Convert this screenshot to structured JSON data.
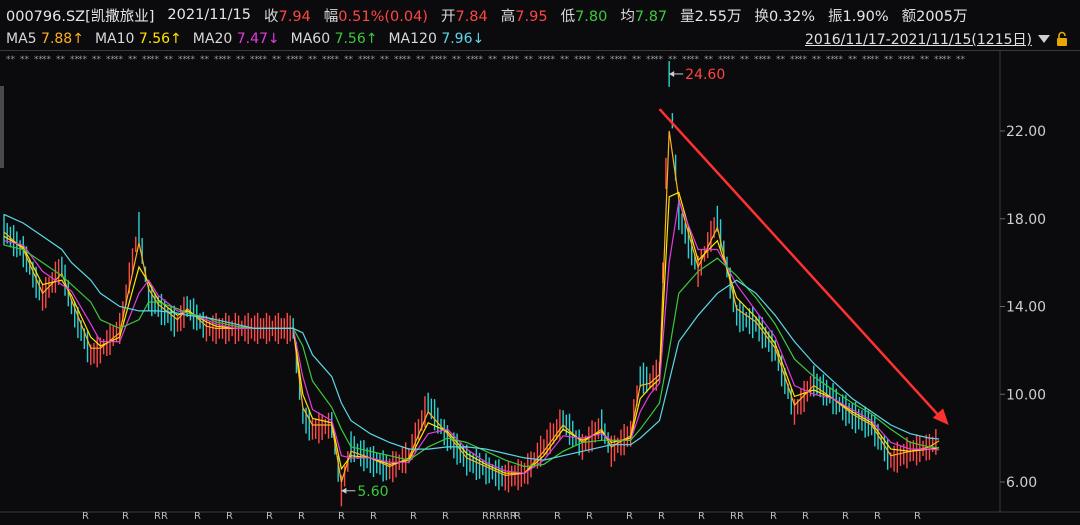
{
  "header": {
    "code": "000796.SZ[凯撒旅业]",
    "date": "2021/11/15",
    "close_label": "收",
    "close": "7.94",
    "change_label": "幅",
    "change": "0.51%(0.04)",
    "open_label": "开",
    "open": "7.84",
    "high_label": "高",
    "high": "7.95",
    "low_label": "低",
    "low": "7.80",
    "avg_label": "均",
    "avg": "7.87",
    "volume_label": "量",
    "volume": "2.55万",
    "turnover_label": "换",
    "turnover": "0.32%",
    "amplitude_label": "振",
    "amplitude": "1.90%",
    "amount_label": "额",
    "amount": "2005万"
  },
  "ma": [
    {
      "label": "MA5",
      "value": "7.88↑",
      "color": "#ffb020"
    },
    {
      "label": "MA10",
      "value": "7.56↑",
      "color": "#ffe600"
    },
    {
      "label": "MA20",
      "value": "7.47↓",
      "color": "#e03ce0"
    },
    {
      "label": "MA60",
      "value": "7.56↑",
      "color": "#3cc83c"
    },
    {
      "label": "MA120",
      "value": "7.96↓",
      "color": "#5bd8e8"
    }
  ],
  "range": {
    "text": "2016/11/17-2021/11/15(1215日)",
    "dropdown_icon": "triangle-down-icon",
    "lock_icon": "lock-icon"
  },
  "chart_data": {
    "type": "line",
    "ylim": [
      5.0,
      25.0
    ],
    "yticks": [
      "22.00",
      "18.00",
      "14.00",
      "10.00",
      "6.00"
    ],
    "grid": false,
    "annotations": [
      {
        "text": "24.60",
        "value": 24.6,
        "color": "#ff4545"
      },
      {
        "text": "5.60",
        "value": 5.6,
        "color": "#3cc83c"
      }
    ],
    "trend_arrow": {
      "from": [
        0.68,
        23.0
      ],
      "to": [
        0.98,
        8.6
      ],
      "color": "#ff3030"
    },
    "x_fraction": [
      0.0,
      0.02,
      0.04,
      0.06,
      0.07,
      0.09,
      0.1,
      0.12,
      0.14,
      0.15,
      0.16,
      0.18,
      0.19,
      0.21,
      0.22,
      0.24,
      0.26,
      0.3,
      0.31,
      0.32,
      0.34,
      0.35,
      0.36,
      0.38,
      0.4,
      0.42,
      0.44,
      0.46,
      0.48,
      0.5,
      0.52,
      0.54,
      0.56,
      0.58,
      0.6,
      0.62,
      0.63,
      0.65,
      0.66,
      0.67,
      0.68,
      0.69,
      0.7,
      0.72,
      0.74,
      0.76,
      0.78,
      0.8,
      0.82,
      0.84,
      0.86,
      0.88,
      0.9,
      0.92,
      0.94,
      0.96,
      0.97
    ],
    "price": [
      17.5,
      16.5,
      14.4,
      15.8,
      14.0,
      11.8,
      12.0,
      13.0,
      17.6,
      14.4,
      14.0,
      13.2,
      14.0,
      13.0,
      13.0,
      13.0,
      13.0,
      13.0,
      9.0,
      8.4,
      8.6,
      5.6,
      7.6,
      7.0,
      6.6,
      7.2,
      9.6,
      8.0,
      7.0,
      6.6,
      6.2,
      6.4,
      7.6,
      8.8,
      7.6,
      8.6,
      7.4,
      8.2,
      10.8,
      10.6,
      11.0,
      24.6,
      18.2,
      15.6,
      18.0,
      13.6,
      13.2,
      12.0,
      9.2,
      10.6,
      9.8,
      9.0,
      8.6,
      7.0,
      7.4,
      7.6,
      7.94
    ],
    "series": [
      {
        "name": "MA5",
        "color": "#ffb020",
        "values": [
          17.4,
          16.6,
          14.6,
          15.5,
          14.3,
          12.1,
          12.1,
          12.8,
          16.9,
          14.8,
          14.1,
          13.4,
          13.9,
          13.1,
          13.0,
          13.0,
          13.0,
          13.0,
          9.4,
          8.6,
          8.6,
          6.0,
          7.4,
          7.1,
          6.7,
          7.1,
          9.2,
          8.2,
          7.1,
          6.7,
          6.3,
          6.4,
          7.4,
          8.6,
          7.8,
          8.4,
          7.6,
          8.1,
          10.4,
          10.5,
          10.9,
          22.0,
          18.9,
          15.8,
          17.6,
          13.9,
          13.3,
          12.1,
          9.5,
          10.4,
          9.8,
          9.1,
          8.6,
          7.2,
          7.4,
          7.6,
          7.88
        ]
      },
      {
        "name": "MA10",
        "color": "#ffe600",
        "values": [
          17.2,
          16.7,
          15.0,
          15.2,
          14.5,
          12.6,
          12.2,
          12.6,
          15.8,
          15.1,
          14.3,
          13.6,
          13.8,
          13.3,
          13.1,
          13.0,
          13.0,
          13.0,
          10.0,
          8.9,
          8.7,
          6.6,
          7.2,
          7.1,
          6.8,
          7.0,
          8.7,
          8.3,
          7.3,
          6.8,
          6.4,
          6.4,
          7.2,
          8.4,
          7.9,
          8.3,
          7.8,
          8.0,
          9.8,
          10.3,
          10.7,
          19.0,
          19.2,
          16.1,
          17.0,
          14.4,
          13.5,
          12.3,
          9.9,
          10.2,
          9.8,
          9.2,
          8.7,
          7.5,
          7.4,
          7.5,
          7.56
        ]
      },
      {
        "name": "MA20",
        "color": "#e03ce0",
        "values": [
          17.0,
          16.8,
          15.6,
          15.0,
          14.7,
          13.2,
          12.4,
          12.4,
          14.6,
          15.2,
          14.5,
          13.8,
          13.7,
          13.4,
          13.2,
          13.0,
          13.0,
          13.0,
          10.8,
          9.3,
          8.8,
          7.2,
          7.1,
          7.1,
          6.9,
          6.9,
          8.2,
          8.4,
          7.5,
          6.9,
          6.5,
          6.4,
          7.0,
          8.1,
          8.0,
          8.2,
          7.9,
          7.9,
          9.2,
          10.0,
          10.5,
          16.0,
          18.8,
          16.6,
          16.6,
          15.0,
          13.8,
          12.6,
          10.4,
          10.0,
          9.8,
          9.3,
          8.8,
          7.8,
          7.5,
          7.5,
          7.47
        ]
      },
      {
        "name": "MA60",
        "color": "#3cc83c",
        "values": [
          16.8,
          16.6,
          16.0,
          15.4,
          15.0,
          14.2,
          13.4,
          13.0,
          13.4,
          14.2,
          14.2,
          13.9,
          13.7,
          13.5,
          13.3,
          13.1,
          13.0,
          13.0,
          12.2,
          10.6,
          9.4,
          8.4,
          7.6,
          7.4,
          7.2,
          7.0,
          7.6,
          8.0,
          7.8,
          7.4,
          7.0,
          6.7,
          6.8,
          7.4,
          7.8,
          7.9,
          7.9,
          7.9,
          8.4,
          9.0,
          9.6,
          12.0,
          14.6,
          15.6,
          16.2,
          15.4,
          14.4,
          13.2,
          11.6,
          10.8,
          10.2,
          9.6,
          9.1,
          8.4,
          7.8,
          7.6,
          7.56
        ]
      },
      {
        "name": "MA120",
        "color": "#5bd8e8",
        "values": [
          18.2,
          17.8,
          17.2,
          16.6,
          16.0,
          15.2,
          14.6,
          14.0,
          13.8,
          13.8,
          13.8,
          13.7,
          13.6,
          13.5,
          13.4,
          13.2,
          13.0,
          13.0,
          12.8,
          11.8,
          10.8,
          9.6,
          8.8,
          8.2,
          7.8,
          7.5,
          7.5,
          7.6,
          7.6,
          7.5,
          7.3,
          7.1,
          7.0,
          7.2,
          7.4,
          7.6,
          7.7,
          7.7,
          8.0,
          8.4,
          8.8,
          10.6,
          12.4,
          13.6,
          14.6,
          15.2,
          14.6,
          13.6,
          12.4,
          11.4,
          10.6,
          9.8,
          9.2,
          8.6,
          8.2,
          8.0,
          7.96
        ]
      }
    ],
    "event_marks": [
      "R",
      "R",
      "RR",
      "R",
      "R",
      "R",
      "R",
      "R",
      "R",
      "R",
      "R",
      "RRRRR",
      "R",
      "R",
      "R",
      "R",
      "R",
      "R",
      "RR",
      "R",
      "R",
      "R",
      "R",
      "R"
    ]
  }
}
